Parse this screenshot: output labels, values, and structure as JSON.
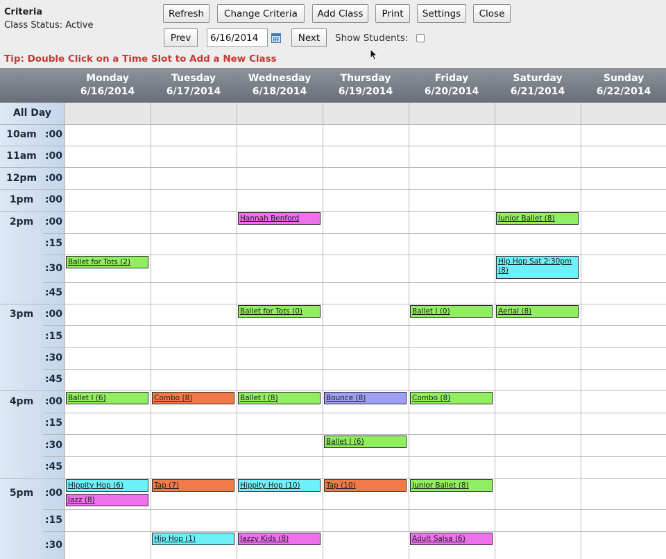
{
  "criteria": {
    "title": "Criteria",
    "status": "Class Status: Active"
  },
  "toolbar": {
    "refresh": "Refresh",
    "change_criteria": "Change Criteria",
    "add_class": "Add Class",
    "print": "Print",
    "settings": "Settings",
    "close": "Close"
  },
  "nav": {
    "prev": "Prev",
    "date": "6/16/2014",
    "next": "Next",
    "show_students_label": "Show Students:",
    "show_students_checked": false
  },
  "tip": "Tip: Double Click on a Time Slot to Add a New Class",
  "days": [
    {
      "name": "Monday",
      "date": "6/16/2014"
    },
    {
      "name": "Tuesday",
      "date": "6/17/2014"
    },
    {
      "name": "Wednesday",
      "date": "6/18/2014"
    },
    {
      "name": "Thursday",
      "date": "6/19/2014"
    },
    {
      "name": "Friday",
      "date": "6/20/2014"
    },
    {
      "name": "Saturday",
      "date": "6/21/2014"
    },
    {
      "name": "Sunday",
      "date": "6/22/2014"
    }
  ],
  "all_day_label": "All Day",
  "rows": [
    {
      "hour": "10am",
      "min": ":00"
    },
    {
      "hour": "11am",
      "min": ":00"
    },
    {
      "hour": "12pm",
      "min": ":00"
    },
    {
      "hour": "1pm",
      "min": ":00"
    },
    {
      "hour": "2pm",
      "min": ":00"
    },
    {
      "hour": "",
      "min": ":15"
    },
    {
      "hour": "",
      "min": ":30"
    },
    {
      "hour": "",
      "min": ":45"
    },
    {
      "hour": "3pm",
      "min": ":00"
    },
    {
      "hour": "",
      "min": ":15"
    },
    {
      "hour": "",
      "min": ":30"
    },
    {
      "hour": "",
      "min": ":45"
    },
    {
      "hour": "4pm",
      "min": ":00"
    },
    {
      "hour": "",
      "min": ":15"
    },
    {
      "hour": "",
      "min": ":30"
    },
    {
      "hour": "",
      "min": ":45"
    },
    {
      "hour": "5pm",
      "min": ":00"
    },
    {
      "hour": "",
      "min": ":15"
    },
    {
      "hour": "",
      "min": ":30"
    }
  ],
  "colors": {
    "green": "#90ee60",
    "magenta": "#ee70ee",
    "cyan": "#6ef0fa",
    "orange": "#f27a48",
    "purple": "#9e9ef4"
  },
  "events": [
    {
      "label": "Hannah Benford",
      "day": 2,
      "slot": 4,
      "color": "magenta"
    },
    {
      "label": "Junior Ballet (8)",
      "day": 5,
      "slot": 4,
      "color": "green"
    },
    {
      "label": "Ballet for Tots (2)",
      "day": 0,
      "slot": 6,
      "color": "green"
    },
    {
      "label": "Hip Hop Sat 2:30pm (8)",
      "day": 5,
      "slot": 6,
      "color": "cyan",
      "tall": true
    },
    {
      "label": "Ballet for Tots (0)",
      "day": 2,
      "slot": 8,
      "color": "green"
    },
    {
      "label": "Ballet I (0)",
      "day": 4,
      "slot": 8,
      "color": "green"
    },
    {
      "label": "Aerial (8)",
      "day": 5,
      "slot": 8,
      "color": "green"
    },
    {
      "label": "Ballet I (6)",
      "day": 0,
      "slot": 12,
      "color": "green"
    },
    {
      "label": "Combo (8)",
      "day": 1,
      "slot": 12,
      "color": "orange"
    },
    {
      "label": "Ballet I (8)",
      "day": 2,
      "slot": 12,
      "color": "green"
    },
    {
      "label": "Bounce (8)",
      "day": 3,
      "slot": 12,
      "color": "purple"
    },
    {
      "label": "Combo (8)",
      "day": 4,
      "slot": 12,
      "color": "green"
    },
    {
      "label": "Ballet I (6)",
      "day": 3,
      "slot": 14,
      "color": "green"
    },
    {
      "label": "Hippity Hop (6)",
      "day": 0,
      "slot": 16,
      "color": "cyan"
    },
    {
      "label": "Jazz (8)",
      "day": 0,
      "slot": 16,
      "color": "magenta",
      "stack": 1
    },
    {
      "label": "Tap (7)",
      "day": 1,
      "slot": 16,
      "color": "orange"
    },
    {
      "label": "Hippity Hop (10)",
      "day": 2,
      "slot": 16,
      "color": "cyan"
    },
    {
      "label": "Tap (10)",
      "day": 3,
      "slot": 16,
      "color": "orange"
    },
    {
      "label": "Junior Ballet (8)",
      "day": 4,
      "slot": 16,
      "color": "green"
    },
    {
      "label": "Hip Hop (1)",
      "day": 1,
      "slot": 18,
      "color": "cyan"
    },
    {
      "label": "Jazzy Kids (8)",
      "day": 2,
      "slot": 18,
      "color": "magenta"
    },
    {
      "label": "Adult Salsa (6)",
      "day": 4,
      "slot": 18,
      "color": "magenta"
    }
  ]
}
